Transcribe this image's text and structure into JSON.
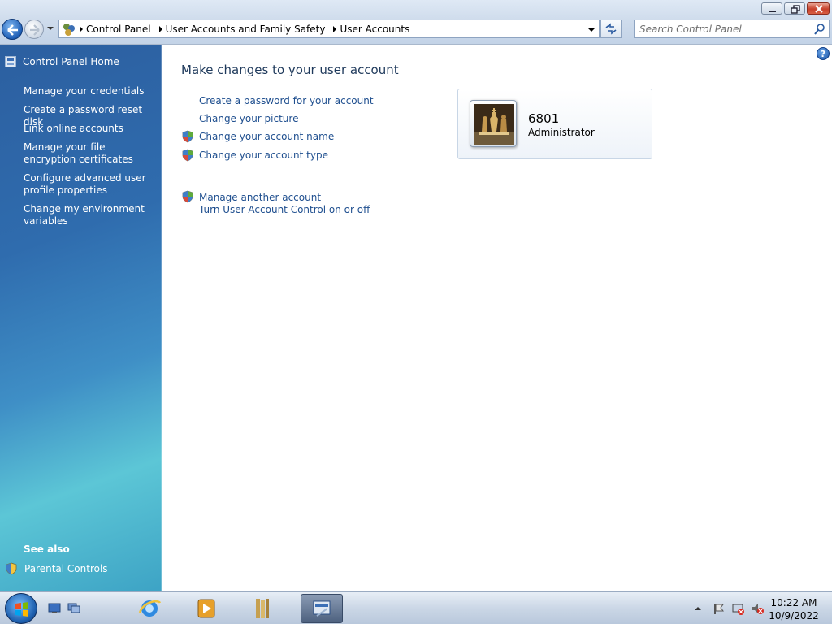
{
  "window": {
    "minimize_label": "",
    "maximize_label": "",
    "close_label": ""
  },
  "address": {
    "breadcrumbs": [
      "Control Panel",
      "User Accounts and Family Safety",
      "User Accounts"
    ],
    "search_placeholder": "Search Control Panel"
  },
  "sidebar": {
    "home": "Control Panel Home",
    "links": [
      "Manage your credentials",
      "Create a password reset disk",
      "Link online accounts",
      "Manage your file encryption certificates",
      "Configure advanced user profile properties",
      "Change my environment variables"
    ],
    "see_also_heading": "See also",
    "see_also_links": [
      "Parental Controls"
    ]
  },
  "main": {
    "title": "Make changes to your user account",
    "tasks": [
      "Create a password for your account",
      "Change your picture",
      "Change your account name",
      "Change your account type"
    ],
    "other_tasks": [
      "Manage another account",
      "Turn User Account Control on or off"
    ],
    "help_label": "?"
  },
  "account": {
    "name": "6801",
    "type": "Administrator"
  },
  "taskbar": {
    "time": "10:22 AM",
    "date": "10/9/2022"
  },
  "icons": {
    "window_close": "close-icon",
    "window_max": "restore-icon",
    "window_min": "minimize-icon",
    "shield": "uac-shield-icon",
    "search": "search-icon"
  }
}
